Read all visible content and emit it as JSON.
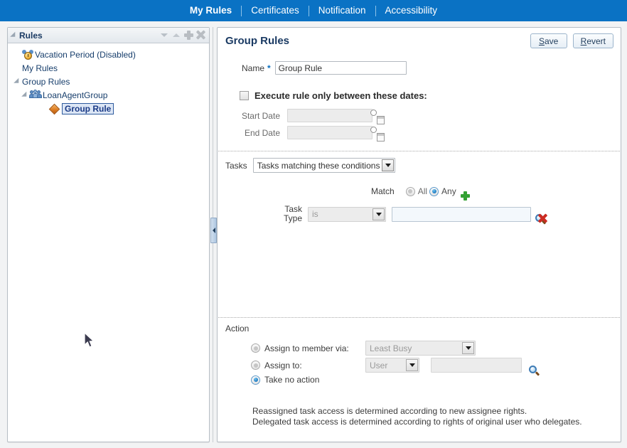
{
  "topnav": {
    "items": [
      {
        "label": "My Rules",
        "active": true
      },
      {
        "label": "Certificates",
        "active": false
      },
      {
        "label": "Notification",
        "active": false
      },
      {
        "label": "Accessibility",
        "active": false
      }
    ]
  },
  "tree_panel": {
    "title": "Rules",
    "header_icons": [
      "triangle-down-icon",
      "triangle-up-icon",
      "plus-icon",
      "delete-icon"
    ],
    "nodes": [
      {
        "label": "Vacation Period (Disabled)",
        "icon": "clock-icon",
        "indent": 1,
        "twisty": false,
        "selected": false
      },
      {
        "label": "My Rules",
        "icon": "none",
        "indent": 1,
        "twisty": false,
        "selected": false
      },
      {
        "label": "Group Rules",
        "icon": "none",
        "indent": 0,
        "twisty": true,
        "selected": false
      },
      {
        "label": "LoanAgentGroup",
        "icon": "group-icon",
        "indent": 1,
        "twisty": true,
        "selected": false
      },
      {
        "label": "Group Rule",
        "icon": "diamond-icon",
        "indent": 3,
        "twisty": false,
        "selected": true
      }
    ]
  },
  "content": {
    "title": "Group Rules",
    "save_label": "Save",
    "save_accel": "S",
    "save_rest": "ave",
    "revert_label": "Revert",
    "revert_accel": "R",
    "revert_rest": "evert",
    "name": {
      "label": "Name",
      "required_marker": "*",
      "value": "Group Rule"
    },
    "dates": {
      "checkbox_label": "Execute rule only between these dates:",
      "checked": false,
      "start_label": "Start Date",
      "start_value": "",
      "end_label": "End Date",
      "end_value": "",
      "picker_icon": "date-picker-icon"
    },
    "tasks": {
      "label": "Tasks",
      "selected": "Tasks matching these conditions",
      "match_label": "Match",
      "match_options": [
        "All",
        "Any"
      ],
      "match_selected": "Any",
      "add_icon": "add-condition-icon",
      "condition": {
        "field_label": "Task Type",
        "operator": "is",
        "value": "",
        "search_icon": "search-icon",
        "delete_icon": "delete-condition-icon"
      }
    },
    "action": {
      "label": "Action",
      "options": [
        {
          "label": "Assign to member via:",
          "selected": false
        },
        {
          "label": "Assign to:",
          "selected": false
        },
        {
          "label": "Take no action",
          "selected": true
        }
      ],
      "member_via_value": "Least Busy",
      "assign_to_type": "User",
      "assign_to_value": "",
      "assign_search_icon": "search-icon",
      "notes": [
        "Reassigned task access is determined according to new assignee rights.",
        "Delegated task access is determined according to rights of original user who delegates."
      ]
    },
    "splitter_icon": "collapse-left-icon"
  },
  "colors": {
    "nav_bg": "#0a72c4",
    "title_blue": "#1a3a63",
    "accent_green": "#33a133",
    "accent_red": "#cc2b22",
    "selection_blue": "#dce6f5"
  }
}
